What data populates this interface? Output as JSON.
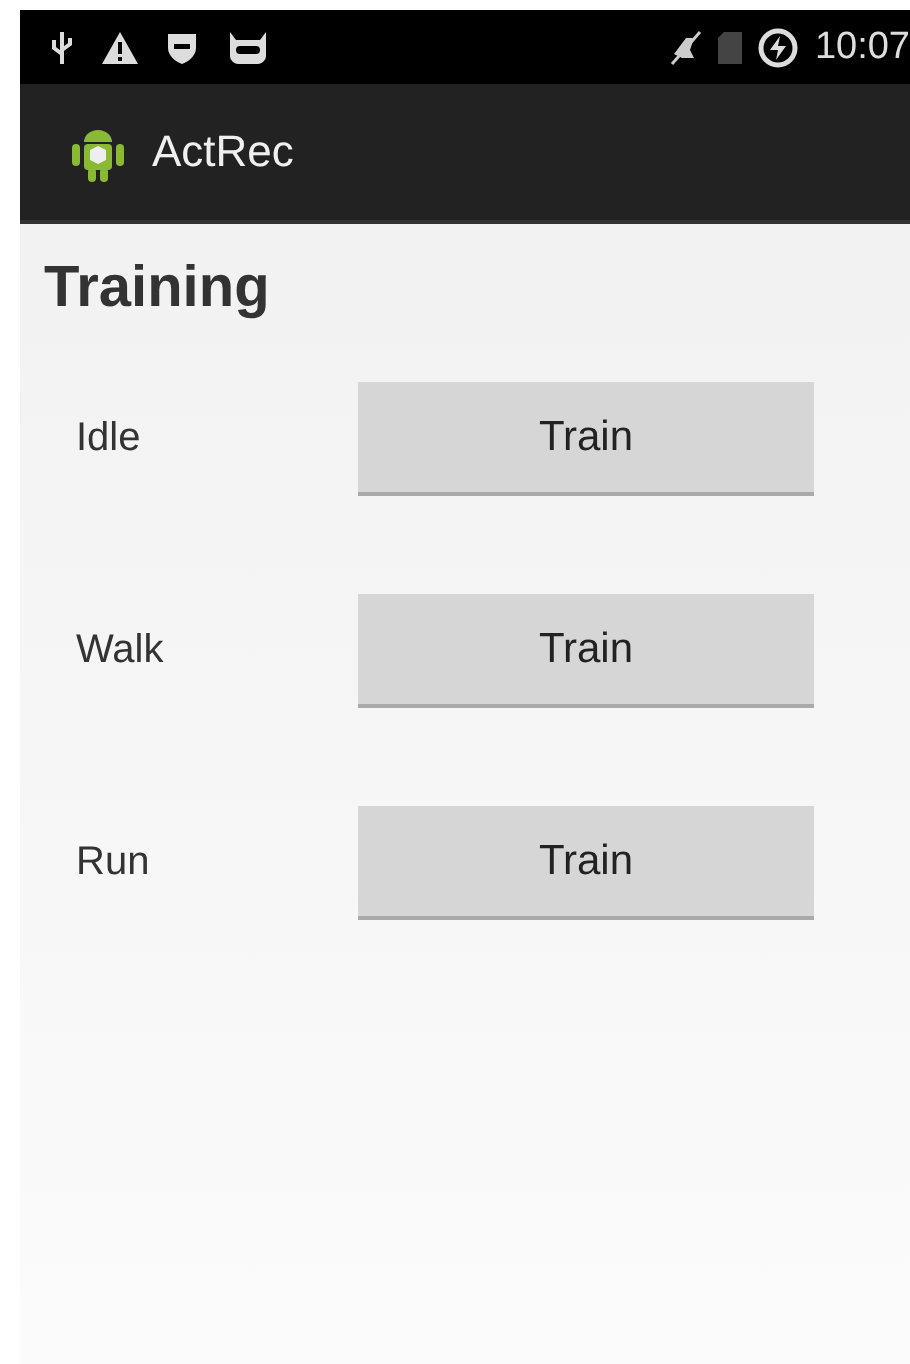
{
  "status_bar": {
    "time": "10:07"
  },
  "action_bar": {
    "title": "ActRec"
  },
  "heading": "Training",
  "activities": [
    {
      "label": "Idle",
      "button": "Train"
    },
    {
      "label": "Walk",
      "button": "Train"
    },
    {
      "label": "Run",
      "button": "Train"
    }
  ]
}
